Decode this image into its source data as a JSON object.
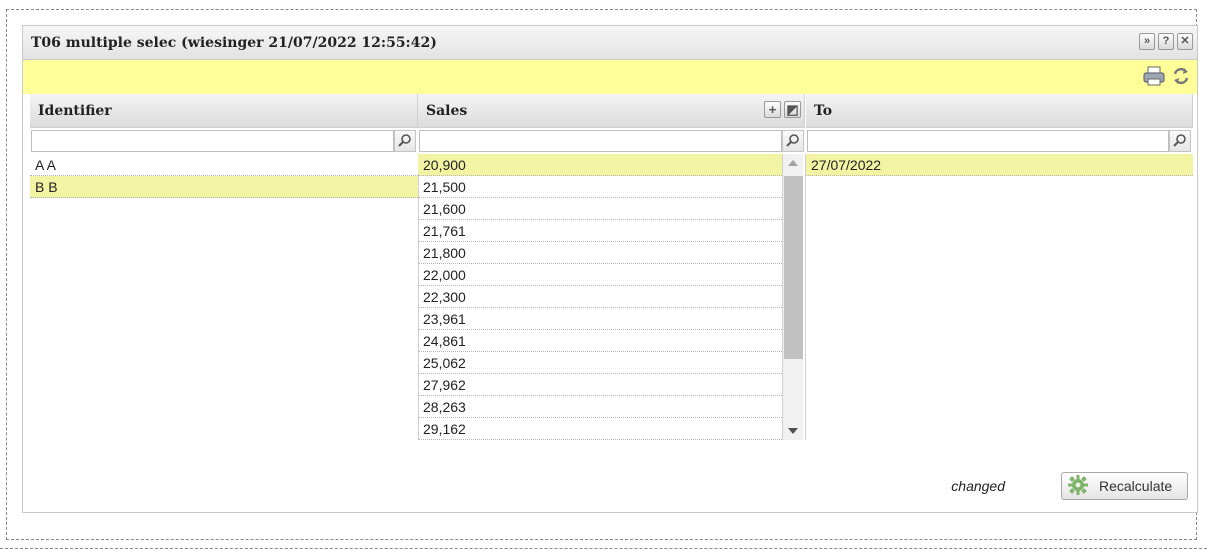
{
  "window": {
    "title": "T06 multiple selec (wiesinger 21/07/2022 12:55:42)",
    "buttons": [
      "»",
      "?",
      "✕"
    ]
  },
  "toolbar": {
    "icons": [
      "print-icon",
      "refresh-icon"
    ]
  },
  "columns": {
    "identifier": {
      "header": "Identifier",
      "filter_value": "",
      "rows": [
        {
          "text": "A A",
          "selected": false
        },
        {
          "text": "B B",
          "selected": true
        }
      ]
    },
    "sales": {
      "header": "Sales",
      "filter_value": "",
      "header_buttons": [
        "+",
        "◩"
      ],
      "rows": [
        {
          "text": "20,900",
          "selected": true
        },
        {
          "text": "21,500",
          "selected": false
        },
        {
          "text": "21,600",
          "selected": false
        },
        {
          "text": "21,761",
          "selected": false
        },
        {
          "text": "21,800",
          "selected": false
        },
        {
          "text": "22,000",
          "selected": false
        },
        {
          "text": "22,300",
          "selected": false
        },
        {
          "text": "23,961",
          "selected": false
        },
        {
          "text": "24,861",
          "selected": false
        },
        {
          "text": "25,062",
          "selected": false
        },
        {
          "text": "27,962",
          "selected": false
        },
        {
          "text": "28,263",
          "selected": false
        },
        {
          "text": "29,162",
          "selected": false
        }
      ]
    },
    "to": {
      "header": "To",
      "filter_value": "",
      "rows": [
        {
          "text": "27/07/2022",
          "selected": true
        }
      ]
    }
  },
  "footer": {
    "status": "changed",
    "recalculate_label": "Recalculate"
  },
  "colors": {
    "toolbar_bg": "#ffff99",
    "selected_row": "#f3f3a4"
  }
}
